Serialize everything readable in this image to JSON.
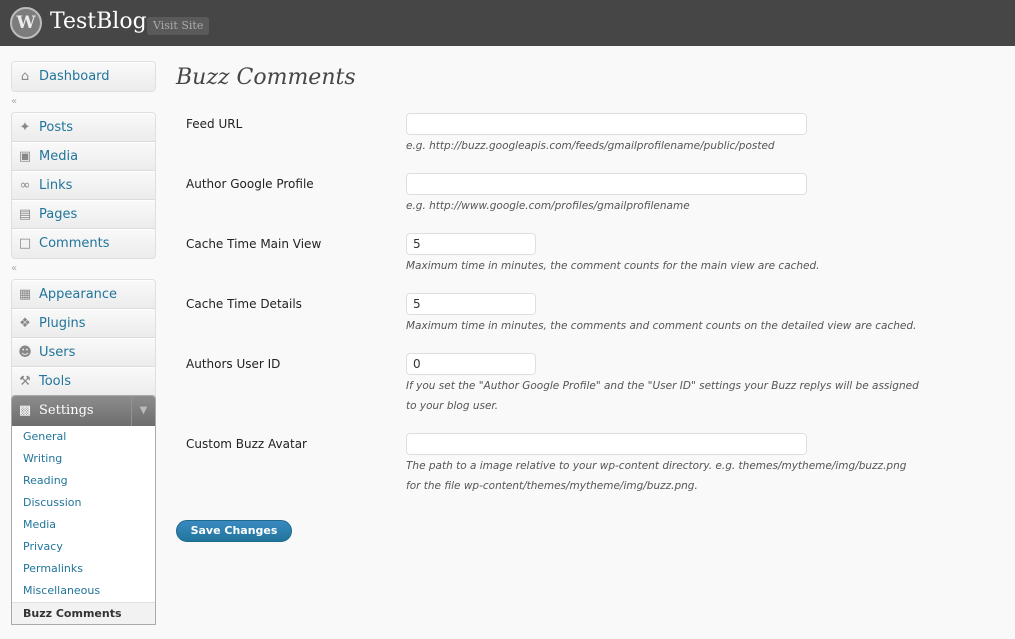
{
  "header": {
    "logo_glyph": "W",
    "site_title": "TestBlog",
    "visit_site": "Visit Site"
  },
  "sidebar": {
    "dashboard": {
      "label": "Dashboard",
      "icon": "home-icon"
    },
    "content": [
      {
        "label": "Posts",
        "icon": "pin-icon"
      },
      {
        "label": "Media",
        "icon": "media-icon"
      },
      {
        "label": "Links",
        "icon": "link-icon"
      },
      {
        "label": "Pages",
        "icon": "pages-icon"
      },
      {
        "label": "Comments",
        "icon": "comment-icon"
      }
    ],
    "admin": [
      {
        "label": "Appearance",
        "icon": "appearance-icon"
      },
      {
        "label": "Plugins",
        "icon": "plugin-icon"
      },
      {
        "label": "Users",
        "icon": "users-icon"
      },
      {
        "label": "Tools",
        "icon": "tools-icon"
      }
    ],
    "settings": {
      "label": "Settings",
      "icon": "settings-icon",
      "submenu": [
        "General",
        "Writing",
        "Reading",
        "Discussion",
        "Media",
        "Privacy",
        "Permalinks",
        "Miscellaneous",
        "Buzz Comments"
      ],
      "current": "Buzz Comments"
    }
  },
  "main": {
    "title": "Buzz Comments",
    "fields": [
      {
        "label": "Feed URL",
        "value": "",
        "desc": [
          "e.g. http://buzz.googleapis.com/feeds/gmailprofilename/public/posted"
        ]
      },
      {
        "label": "Author Google Profile",
        "value": "",
        "desc": [
          "e.g. http://www.google.com/profiles/gmailprofilename"
        ]
      },
      {
        "label": "Cache Time Main View",
        "value": "5",
        "desc": [
          "Maximum time in minutes, the comment counts for the main view are cached."
        ]
      },
      {
        "label": "Cache Time Details",
        "value": "5",
        "desc": [
          "Maximum time in minutes, the comments and comment counts on the detailed view are cached."
        ]
      },
      {
        "label": "Authors User ID",
        "value": "0",
        "desc": [
          "If you set the \"Author Google Profile\" and the \"User ID\" settings your Buzz replys will be assigned",
          "to your blog user."
        ]
      },
      {
        "label": "Custom Buzz Avatar",
        "value": "",
        "desc": [
          "The path to a image relative to your wp-content directory. e.g. themes/mytheme/img/buzz.png",
          "for the file wp-content/themes/mytheme/img/buzz.png."
        ]
      }
    ],
    "save_label": "Save Changes"
  },
  "colors": {
    "header_bg": "#464646",
    "link": "#21759b",
    "button": "#21759b"
  }
}
